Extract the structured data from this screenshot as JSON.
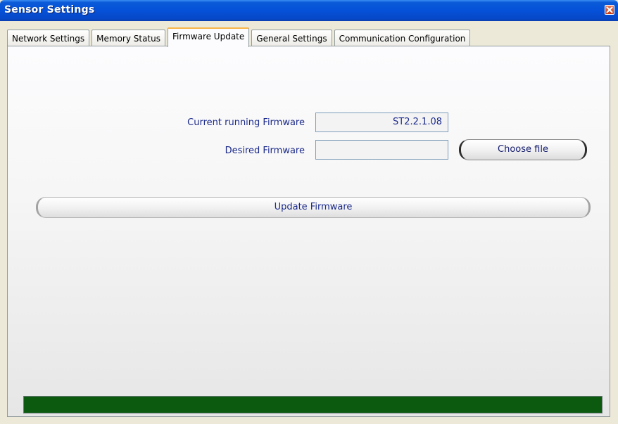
{
  "window": {
    "title": "Sensor Settings"
  },
  "tabs": [
    {
      "label": "Network Settings",
      "active": false
    },
    {
      "label": "Memory Status",
      "active": false
    },
    {
      "label": "Firmware Update",
      "active": true
    },
    {
      "label": "General Settings",
      "active": false
    },
    {
      "label": "Communication Configuration",
      "active": false
    }
  ],
  "firmware": {
    "current_label": "Current running Firmware",
    "current_value": "ST2.2.1.08",
    "desired_label": "Desired Firmware",
    "desired_value": "",
    "choose_file_label": "Choose file",
    "update_label": "Update Firmware"
  },
  "progress": {
    "fraction": 1.0,
    "color": "#0c5a10"
  },
  "colors": {
    "titlebar": "#0551d8",
    "active_tab_accent": "#f9b64a",
    "label_text": "#1b2a8a"
  }
}
